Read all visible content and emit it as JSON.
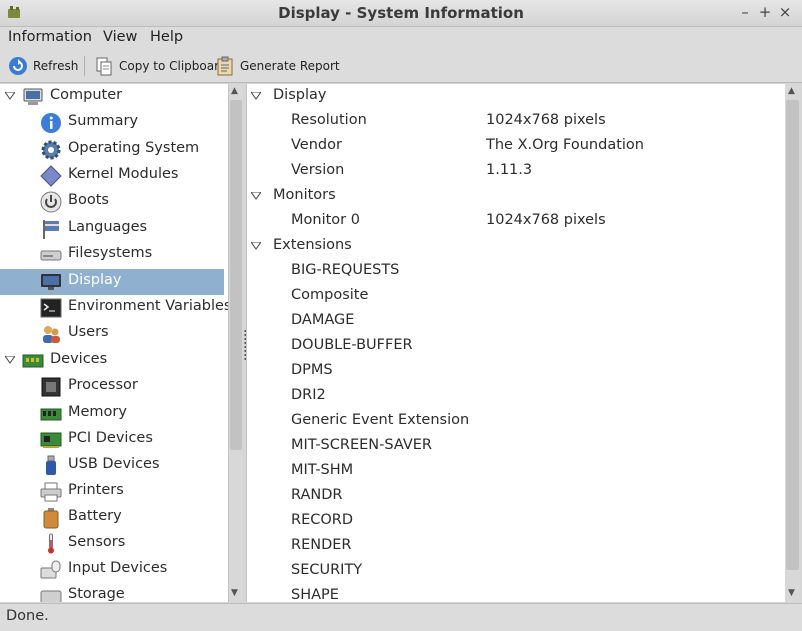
{
  "window": {
    "title": "Display - System Information"
  },
  "menubar": [
    "Information",
    "View",
    "Help"
  ],
  "toolbar": {
    "refresh": "Refresh",
    "copy": "Copy to Clipboard",
    "report": "Generate Report"
  },
  "tree": {
    "computer": {
      "label": "Computer",
      "items": [
        {
          "label": "Summary",
          "icon": "info-icon"
        },
        {
          "label": "Operating System",
          "icon": "gear-icon"
        },
        {
          "label": "Kernel Modules",
          "icon": "module-icon"
        },
        {
          "label": "Boots",
          "icon": "power-icon"
        },
        {
          "label": "Languages",
          "icon": "flag-icon"
        },
        {
          "label": "Filesystems",
          "icon": "drive-icon"
        },
        {
          "label": "Display",
          "icon": "monitor-icon",
          "selected": true
        },
        {
          "label": "Environment Variables",
          "icon": "terminal-icon"
        },
        {
          "label": "Users",
          "icon": "users-icon"
        }
      ]
    },
    "devices": {
      "label": "Devices",
      "items": [
        {
          "label": "Processor",
          "icon": "cpu-icon"
        },
        {
          "label": "Memory",
          "icon": "memory-icon"
        },
        {
          "label": "PCI Devices",
          "icon": "pci-icon"
        },
        {
          "label": "USB Devices",
          "icon": "usb-icon"
        },
        {
          "label": "Printers",
          "icon": "printer-icon"
        },
        {
          "label": "Battery",
          "icon": "battery-icon"
        },
        {
          "label": "Sensors",
          "icon": "thermometer-icon"
        },
        {
          "label": "Input Devices",
          "icon": "keyboard-icon"
        },
        {
          "label": "Storage",
          "icon": "storage-icon"
        }
      ]
    }
  },
  "details": {
    "display": {
      "label": "Display",
      "rows": [
        {
          "key": "Resolution",
          "value": "1024x768 pixels"
        },
        {
          "key": "Vendor",
          "value": "The X.Org Foundation"
        },
        {
          "key": "Version",
          "value": "1.11.3"
        }
      ]
    },
    "monitors": {
      "label": "Monitors",
      "rows": [
        {
          "key": "Monitor 0",
          "value": "1024x768 pixels"
        }
      ]
    },
    "extensions": {
      "label": "Extensions",
      "rows": [
        {
          "key": "BIG-REQUESTS"
        },
        {
          "key": "Composite"
        },
        {
          "key": "DAMAGE"
        },
        {
          "key": "DOUBLE-BUFFER"
        },
        {
          "key": "DPMS"
        },
        {
          "key": "DRI2"
        },
        {
          "key": "Generic Event Extension"
        },
        {
          "key": "MIT-SCREEN-SAVER"
        },
        {
          "key": "MIT-SHM"
        },
        {
          "key": "RANDR"
        },
        {
          "key": "RECORD"
        },
        {
          "key": "RENDER"
        },
        {
          "key": "SECURITY"
        },
        {
          "key": "SHAPE"
        }
      ]
    }
  },
  "status": "Done.",
  "colors": {
    "selection": "#8fb1cf",
    "accent": "#3a7bd5"
  }
}
